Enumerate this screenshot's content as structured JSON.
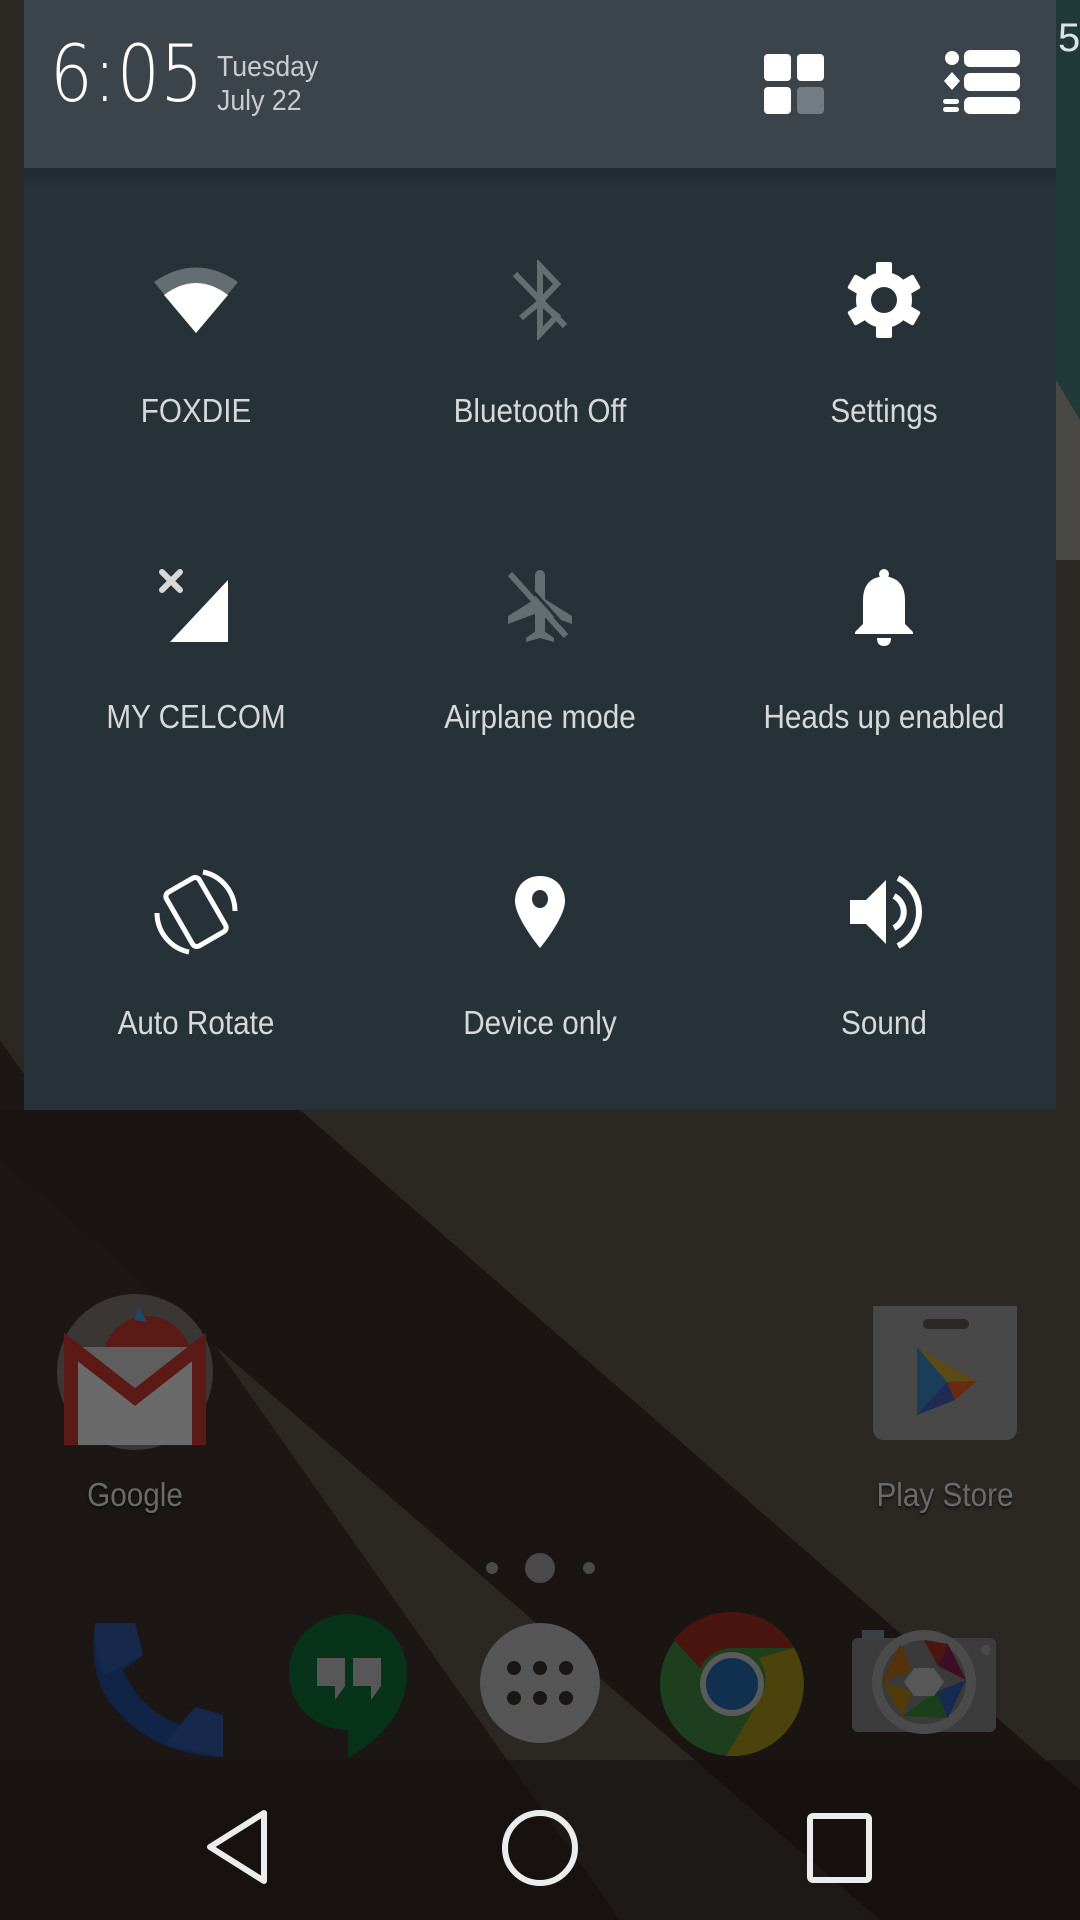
{
  "header": {
    "time": "6:05",
    "day": "Tuesday",
    "date": "July 22",
    "buttons": [
      {
        "name": "quick-settings-grid",
        "icon": "grid-icon"
      },
      {
        "name": "notification-list",
        "icon": "list-icon"
      }
    ]
  },
  "tiles": [
    {
      "label": "FOXDIE",
      "icon": "wifi-icon",
      "state": "on"
    },
    {
      "label": "Bluetooth Off",
      "icon": "bluetooth-off-icon",
      "state": "off"
    },
    {
      "label": "Settings",
      "icon": "gear-icon",
      "state": "on"
    },
    {
      "label": "MY CELCOM",
      "icon": "cell-signal-icon",
      "state": "on"
    },
    {
      "label": "Airplane mode",
      "icon": "airplane-off-icon",
      "state": "off"
    },
    {
      "label": "Heads up enabled",
      "icon": "bell-icon",
      "state": "on"
    },
    {
      "label": "Auto Rotate",
      "icon": "rotate-icon",
      "state": "on"
    },
    {
      "label": "Device only",
      "icon": "location-pin-icon",
      "state": "on"
    },
    {
      "label": "Sound",
      "icon": "volume-icon",
      "state": "on"
    }
  ],
  "home": {
    "apps": [
      {
        "label": "Google",
        "icon": "google-folder-icon"
      },
      {
        "label": "Play Store",
        "icon": "play-store-icon"
      }
    ],
    "page_indicator": {
      "pages": 3,
      "current": 2
    },
    "dock": [
      {
        "name": "phone",
        "icon": "phone-icon"
      },
      {
        "name": "hangouts",
        "icon": "hangouts-icon"
      },
      {
        "name": "app-drawer",
        "icon": "app-drawer-icon"
      },
      {
        "name": "chrome",
        "icon": "chrome-icon"
      },
      {
        "name": "camera",
        "icon": "camera-icon"
      }
    ]
  },
  "navbar": {
    "buttons": [
      "back",
      "home",
      "recents"
    ]
  },
  "colors": {
    "header_bg": "#3b434b",
    "panel_bg": "#263238",
    "icon_on": "#ffffff",
    "icon_off": "#646d72",
    "label": "#d6d9db"
  }
}
